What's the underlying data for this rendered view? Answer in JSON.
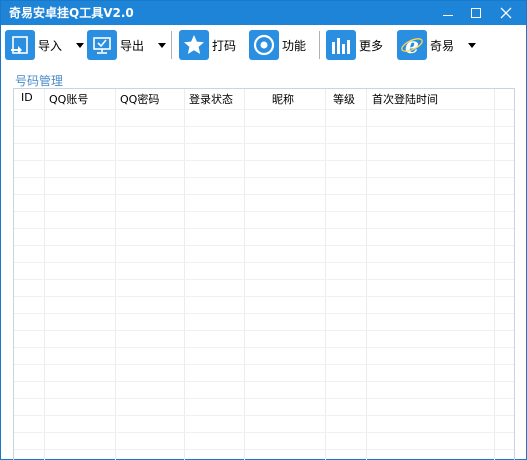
{
  "window": {
    "title": "奇易安卓挂Q工具V2.0",
    "controls": {
      "minimize": "—",
      "maximize": "□",
      "close": "✕"
    }
  },
  "toolbar": {
    "import_label": "导入",
    "export_label": "导出",
    "captcha_label": "打码",
    "function_label": "功能",
    "more_label": "更多",
    "qiyi_label": "奇易"
  },
  "group": {
    "label": "号码管理"
  },
  "table": {
    "columns": [
      "ID",
      "QQ账号",
      "QQ密码",
      "登录状态",
      "昵称",
      "等级",
      "首次登陆时间"
    ],
    "rows": []
  },
  "colors": {
    "titlebar": "#1e84d8",
    "icon_blue": "#2a8fe0",
    "group_label": "#4a8cc8"
  }
}
